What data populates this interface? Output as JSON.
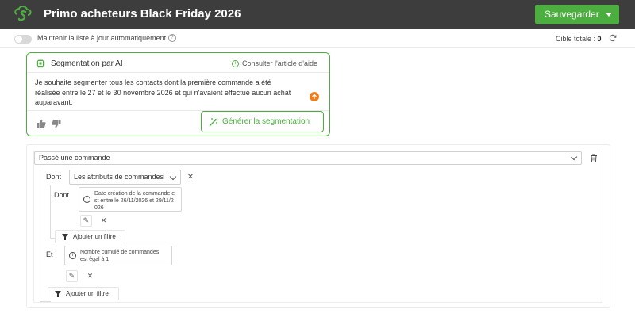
{
  "header": {
    "title": "Primo acheteurs Black Friday 2026",
    "save_label": "Sauvegarder",
    "logo_icon": "brand-s-logo-icon",
    "accent": "#4cae3f",
    "bar_color": "#3d3d3d"
  },
  "toolbar": {
    "auto_update_label": "Maintenir la liste à jour automatiquement",
    "auto_update_enabled": false,
    "help_symbol": "?",
    "target_label": "Cible totale :",
    "target_value": "0"
  },
  "ai_panel": {
    "title": "Segmentation par AI",
    "help_link": "Consulter l'article d'aide",
    "help_symbol": "i",
    "prompt_text": "Je souhaite segmenter tous les contacts dont la première commande a été réalisée entre le 27 et le 30 novembre 2026 et qui n'avaient effectué aucun achat auparavant.",
    "generate_label": "Générer la segmentation",
    "send_color": "#f07d19"
  },
  "segment": {
    "condition_label": "Passé une commande",
    "dont_label_1": "Dont",
    "attribute_select": "Les attributs de commandes",
    "dont_label_2": "Dont",
    "filter_1_text": "Date création de la commande est entre le 26/11/2026 et 29/11/2026",
    "filter_1_lines": [
      "Date création de la commande e",
      "st entre le 26/11/2026 et 29/11/2",
      "026"
    ],
    "add_filter_label": "Ajouter un filtre",
    "et_label": "Et",
    "filter_2_text": "Nombre cumulé de commandes est égal à 1",
    "filter_2_lines": [
      "Nombre cumulé de commandes",
      "est égal à 1"
    ],
    "add_filter_label_2": "Ajouter un filtre",
    "info_symbol": "i",
    "remove_symbol": "✕",
    "edit_symbol": "✎"
  }
}
